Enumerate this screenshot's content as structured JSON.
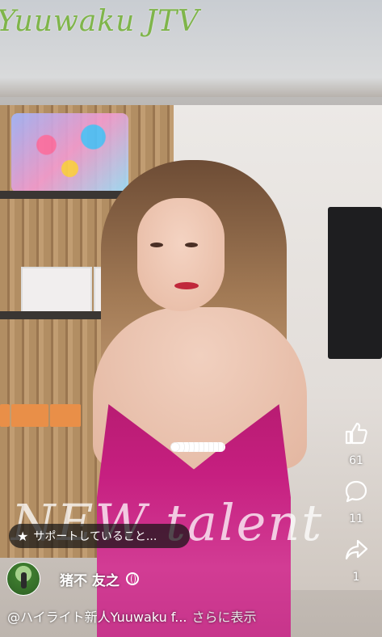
{
  "overlay": {
    "brand_text": "Yuuwaku JTV",
    "watermark_text": "NEW talent"
  },
  "support": {
    "label": "サポートしていること..."
  },
  "author": {
    "name": "猪不 友之"
  },
  "caption": {
    "text": "@ハイライト新人Yuuwaku f...",
    "more_label": "さらに表示"
  },
  "actions": {
    "like_count": "61",
    "comment_count": "11",
    "share_count": "1"
  },
  "icons": [
    "thumbs-up-icon",
    "comment-icon",
    "share-icon",
    "globe-icon",
    "star-icon"
  ]
}
